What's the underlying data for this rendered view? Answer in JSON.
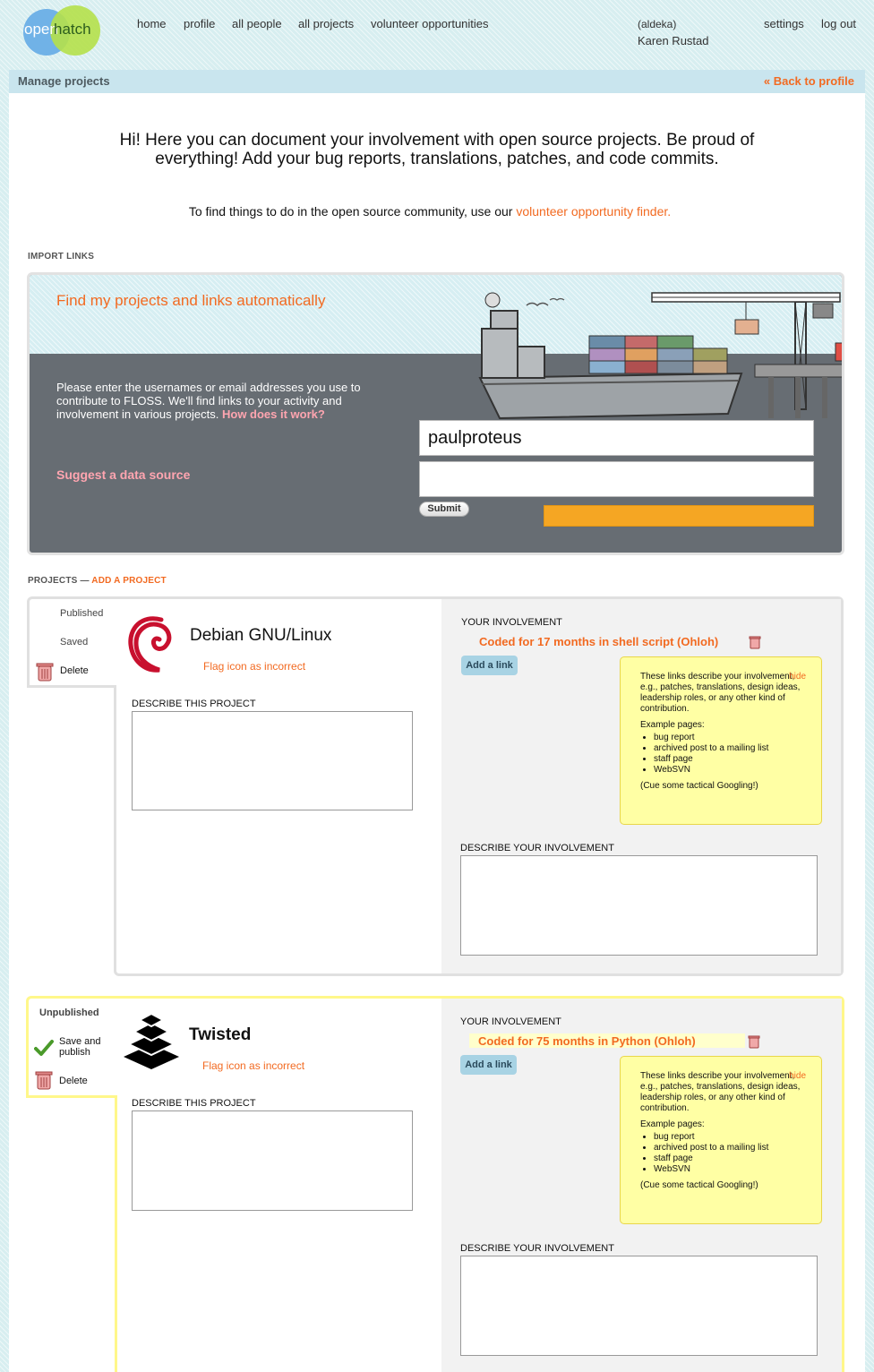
{
  "header": {
    "logo": {
      "part1": "open",
      "part2": "hatch"
    },
    "nav": [
      "home",
      "profile",
      "all people",
      "all projects",
      "volunteer opportunities"
    ],
    "user": {
      "name": "Karen Rustad",
      "username": "(aldeka)"
    },
    "settings": "settings",
    "logout": "log out"
  },
  "page": {
    "title": "Manage projects",
    "back_link": "« Back to profile",
    "intro": "Hi! Here you can document your involvement with open source projects. Be proud of everything! Add your bug reports, translations, patches, and code commits.",
    "finder_prefix": "To find things to do in the open source community, use our ",
    "finder_link": "volunteer opportunity finder."
  },
  "import": {
    "section_label": "IMPORT LINKS",
    "title": "Find my projects and links automatically",
    "description": "Please enter the usernames or email addresses you use to contribute to FLOSS. We'll find links to your activity and involvement in various projects.",
    "how_link": "How does it work?",
    "suggest": "Suggest a data source",
    "input1_value": "paulproteus",
    "input2_value": "",
    "submit": "Submit",
    "progress_fraction": 1.0,
    "colors": {
      "progress": "#f5a623",
      "panel": "#676d73"
    }
  },
  "projects_section": {
    "label": "PROJECTS —",
    "add_link": "ADD A PROJECT"
  },
  "tip": {
    "hide": "hide",
    "text": "These links describe your involvement, e.g., patches, translations, design ideas, leadership roles, or any other kind of contribution.",
    "example_heading": "Example pages:",
    "examples": [
      "bug report",
      "archived post to a mailing list",
      "staff page",
      "WebSVN"
    ],
    "cue": "(Cue some tactical Googling!)"
  },
  "projects": [
    {
      "name": "Debian GNU/Linux",
      "status1": "Published",
      "status2": "Saved",
      "delete": "Delete",
      "flag": "Flag icon as incorrect",
      "describe_project": "DESCRIBE THIS PROJECT",
      "your_involvement": "YOUR INVOLVEMENT",
      "involvement_link": "Coded for 17 months in shell script (Ohloh)",
      "add_link": "Add a link",
      "describe_involvement": "DESCRIBE YOUR INVOLVEMENT",
      "icon": "debian-swirl-icon"
    },
    {
      "name": "Twisted",
      "status1": "Unpublished",
      "save_publish": "Save and publish",
      "delete": "Delete",
      "flag": "Flag icon as incorrect",
      "describe_project": "DESCRIBE THIS PROJECT",
      "your_involvement": "YOUR INVOLVEMENT",
      "involvement_link": "Coded for 75 months in Python (Ohloh)",
      "add_link": "Add a link",
      "describe_involvement": "DESCRIBE YOUR INVOLVEMENT",
      "icon": "twisted-stack-icon"
    }
  ]
}
